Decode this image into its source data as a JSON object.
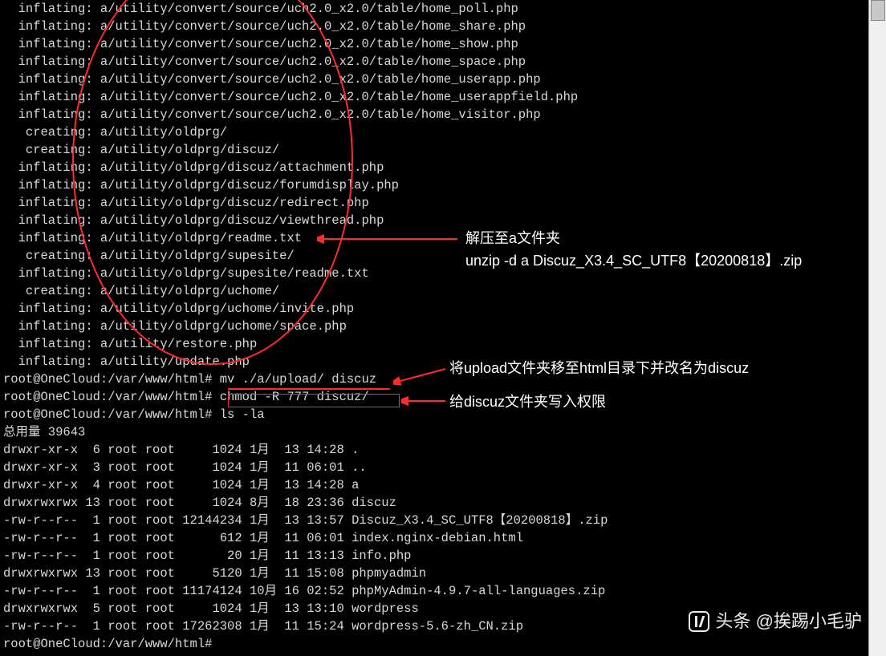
{
  "inflating_lines": [
    "  inflating: a/utility/convert/source/uch2.0_x2.0/table/home_poll.php",
    "  inflating: a/utility/convert/source/uch2.0_x2.0/table/home_share.php",
    "  inflating: a/utility/convert/source/uch2.0_x2.0/table/home_show.php",
    "  inflating: a/utility/convert/source/uch2.0_x2.0/table/home_space.php",
    "  inflating: a/utility/convert/source/uch2.0_x2.0/table/home_userapp.php",
    "  inflating: a/utility/convert/source/uch2.0_x2.0/table/home_userappfield.php",
    "  inflating: a/utility/convert/source/uch2.0_x2.0/table/home_visitor.php",
    "   creating: a/utility/oldprg/",
    "   creating: a/utility/oldprg/discuz/",
    "  inflating: a/utility/oldprg/discuz/attachment.php",
    "  inflating: a/utility/oldprg/discuz/forumdisplay.php",
    "  inflating: a/utility/oldprg/discuz/redirect.php",
    "  inflating: a/utility/oldprg/discuz/viewthread.php",
    "  inflating: a/utility/oldprg/readme.txt",
    "   creating: a/utility/oldprg/supesite/",
    "  inflating: a/utility/oldprg/supesite/readme.txt",
    "   creating: a/utility/oldprg/uchome/",
    "  inflating: a/utility/oldprg/uchome/invite.php",
    "  inflating: a/utility/oldprg/uchome/space.php",
    "  inflating: a/utility/restore.php",
    "  inflating: a/utility/update.php"
  ],
  "prompt1": {
    "prompt": "root@OneCloud:/var/www/html# ",
    "cmd": "mv ./a/upload/ discuz"
  },
  "prompt2": {
    "prompt": "root@OneCloud:/var/www/html# ",
    "cmd": "chmod -R 777 discuz/"
  },
  "prompt3": {
    "prompt": "root@OneCloud:/var/www/html# ",
    "cmd": "ls -la"
  },
  "total": "总用量 39643",
  "ls": [
    "drwxr-xr-x  6 root root     1024 1月  13 14:28 .",
    "drwxr-xr-x  3 root root     1024 1月  11 06:01 ..",
    "drwxr-xr-x  4 root root     1024 1月  13 14:28 a",
    "drwxrwxrwx 13 root root     1024 8月  18 23:36 discuz",
    "-rw-r--r--  1 root root 12144234 1月  13 13:57 Discuz_X3.4_SC_UTF8【20200818】.zip",
    "-rw-r--r--  1 root root      612 1月  11 06:01 index.nginx-debian.html",
    "-rw-r--r--  1 root root       20 1月  11 13:13 info.php",
    "drwxrwxrwx 13 root root     5120 1月  11 15:08 phpmyadmin",
    "-rw-r--r--  1 root root 11174124 10月 16 02:52 phpMyAdmin-4.9.7-all-languages.zip",
    "drwxrwxrwx  5 root root     1024 1月  13 13:10 wordpress",
    "-rw-r--r--  1 root root 17262308 1月  11 15:24 wordpress-5.6-zh_CN.zip"
  ],
  "prompt_final": "root@OneCloud:/var/www/html# ",
  "annotations": {
    "unzip_l1": "解压至a文件夹",
    "unzip_l2": "unzip -d a Discuz_X3.4_SC_UTF8【20200818】.zip",
    "mv": "将upload文件夹移至html目录下并改名为discuz",
    "chmod": "给discuz文件夹写入权限"
  },
  "watermark": "头条 @挨踢小毛驴"
}
